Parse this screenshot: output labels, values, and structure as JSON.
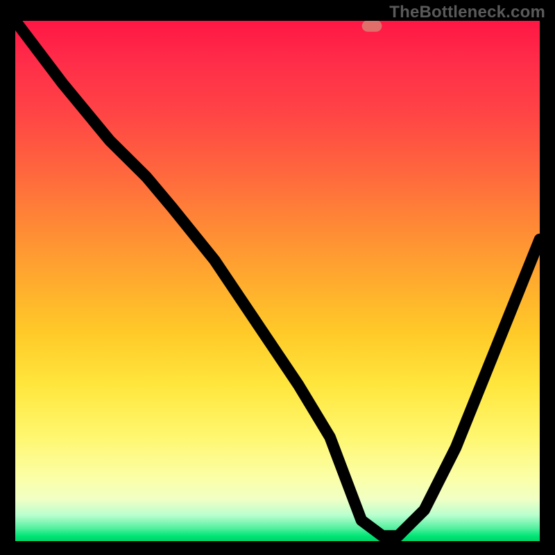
{
  "watermark": "TheBottleneck.com",
  "colors": {
    "page_bg": "#000000",
    "marker_fill": "#e06f6b",
    "curve_stroke": "#000000",
    "gradient_stops": [
      "#ff1744",
      "#ff2d49",
      "#ff4545",
      "#ff6a3d",
      "#ff8b35",
      "#ffab2e",
      "#ffca28",
      "#ffe63d",
      "#fff770",
      "#fbffa8",
      "#f0ffc4",
      "#baffcf",
      "#55f0a0",
      "#00e676",
      "#00d26a"
    ]
  },
  "chart_data": {
    "type": "line",
    "title": "",
    "xlabel": "",
    "ylabel": "",
    "ylim": [
      0,
      100
    ],
    "marker": {
      "x": 68,
      "y": 99
    },
    "series": [
      {
        "name": "bottleneck-curve",
        "x": [
          0,
          9,
          18,
          25,
          30,
          38,
          46,
          54,
          60,
          63,
          66,
          70,
          73,
          78,
          84,
          90,
          96,
          100
        ],
        "y": [
          100,
          88,
          77,
          70,
          64,
          54,
          42,
          30,
          20,
          12,
          4,
          1,
          1,
          6,
          18,
          33,
          48,
          58
        ]
      }
    ]
  }
}
